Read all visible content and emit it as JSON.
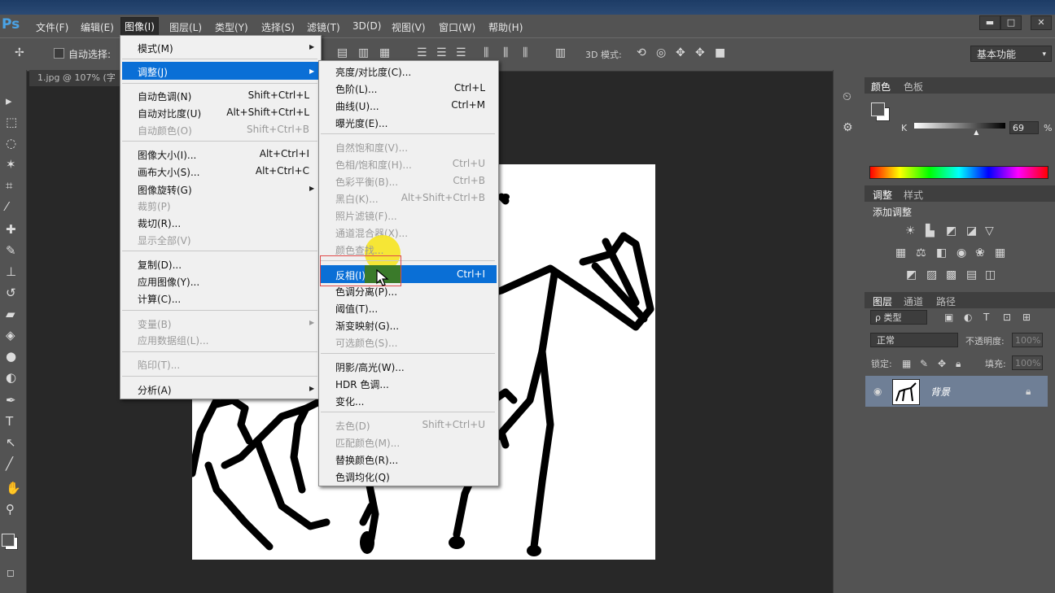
{
  "app": {
    "logo": "Ps"
  },
  "menubar": {
    "items": [
      "文件(F)",
      "编辑(E)",
      "图像(I)",
      "图层(L)",
      "类型(Y)",
      "选择(S)",
      "滤镜(T)",
      "3D(D)",
      "视图(V)",
      "窗口(W)",
      "帮助(H)"
    ],
    "window_buttons": [
      "▬",
      "□",
      "✕"
    ]
  },
  "options": {
    "auto_select_label": "自动选择:",
    "mode_3d_label": "3D 模式:",
    "workspace_value": "基本功能"
  },
  "document": {
    "tab_title": "1.jpg @ 107% (字"
  },
  "image_menu": {
    "items": [
      {
        "label": "模式(M)",
        "submenu": true
      },
      {
        "label": "调整(J)",
        "submenu": true,
        "highlight": true
      },
      {
        "label": "自动色调(N)",
        "shortcut": "Shift+Ctrl+L"
      },
      {
        "label": "自动对比度(U)",
        "shortcut": "Alt+Shift+Ctrl+L"
      },
      {
        "label": "自动颜色(O)",
        "shortcut": "Shift+Ctrl+B",
        "disabled": true
      },
      {
        "label": "图像大小(I)...",
        "shortcut": "Alt+Ctrl+I"
      },
      {
        "label": "画布大小(S)...",
        "shortcut": "Alt+Ctrl+C"
      },
      {
        "label": "图像旋转(G)",
        "submenu": true
      },
      {
        "label": "裁剪(P)",
        "disabled": true
      },
      {
        "label": "裁切(R)..."
      },
      {
        "label": "显示全部(V)",
        "disabled": true
      },
      {
        "label": "复制(D)..."
      },
      {
        "label": "应用图像(Y)..."
      },
      {
        "label": "计算(C)..."
      },
      {
        "label": "变量(B)",
        "submenu": true,
        "disabled": true
      },
      {
        "label": "应用数据组(L)...",
        "disabled": true
      },
      {
        "label": "陷印(T)...",
        "disabled": true
      },
      {
        "label": "分析(A)",
        "submenu": true
      }
    ]
  },
  "adjust_menu": {
    "items": [
      {
        "label": "亮度/对比度(C)..."
      },
      {
        "label": "色阶(L)...",
        "shortcut": "Ctrl+L"
      },
      {
        "label": "曲线(U)...",
        "shortcut": "Ctrl+M"
      },
      {
        "label": "曝光度(E)..."
      },
      {
        "label": "自然饱和度(V)...",
        "disabled": true
      },
      {
        "label": "色相/饱和度(H)...",
        "shortcut": "Ctrl+U",
        "disabled": true
      },
      {
        "label": "色彩平衡(B)...",
        "shortcut": "Ctrl+B",
        "disabled": true
      },
      {
        "label": "黑白(K)...",
        "shortcut": "Alt+Shift+Ctrl+B",
        "disabled": true
      },
      {
        "label": "照片滤镜(F)...",
        "disabled": true
      },
      {
        "label": "通道混合器(X)...",
        "disabled": true
      },
      {
        "label": "颜色查找...",
        "disabled": true
      },
      {
        "label": "反相(I)",
        "shortcut": "Ctrl+I",
        "highlight": true
      },
      {
        "label": "色调分离(P)..."
      },
      {
        "label": "阈值(T)..."
      },
      {
        "label": "渐变映射(G)..."
      },
      {
        "label": "可选颜色(S)...",
        "disabled": true
      },
      {
        "label": "阴影/高光(W)..."
      },
      {
        "label": "HDR 色调..."
      },
      {
        "label": "变化..."
      },
      {
        "label": "去色(D)",
        "shortcut": "Shift+Ctrl+U",
        "disabled": true
      },
      {
        "label": "匹配颜色(M)...",
        "disabled": true
      },
      {
        "label": "替换颜色(R)..."
      },
      {
        "label": "色调均化(Q)"
      }
    ]
  },
  "color_panel": {
    "tabs": [
      "颜色",
      "色板"
    ],
    "channel_label": "K",
    "value": "69",
    "unit": "%",
    "k_level_percent": 69
  },
  "adjust_panel": {
    "tabs": [
      "调整",
      "样式"
    ],
    "title": "添加调整"
  },
  "layers_panel": {
    "tabs": [
      "图层",
      "通道",
      "路径"
    ],
    "filter_label": "ρ 类型",
    "blend_mode": "正常",
    "opacity_label": "不透明度:",
    "opacity_value": "100%",
    "lock_label": "锁定:",
    "fill_label": "填充:",
    "fill_value": "100%",
    "layer_name": "背景"
  },
  "colors": {
    "highlight": "#0a6fd6",
    "cursor_halo": "#f5e52a",
    "accent": "#4aa3e6"
  }
}
